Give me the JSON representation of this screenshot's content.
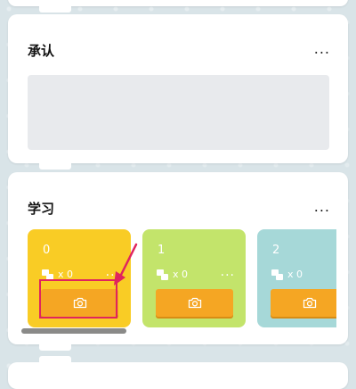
{
  "sections": {
    "first": {
      "title": "承认",
      "more": "..."
    },
    "second": {
      "title": "学习",
      "more": "..."
    }
  },
  "tiles": [
    {
      "number": "0",
      "count": "x 0",
      "more": "...",
      "color": "#f9cc25"
    },
    {
      "number": "1",
      "count": "x 0",
      "more": "...",
      "color": "#c3e46b"
    },
    {
      "number": "2",
      "count": "x 0",
      "more": "...",
      "color": "#a6d8d8"
    }
  ],
  "colors": {
    "camera_button": "#f5a623",
    "highlight": "#e0245e"
  }
}
